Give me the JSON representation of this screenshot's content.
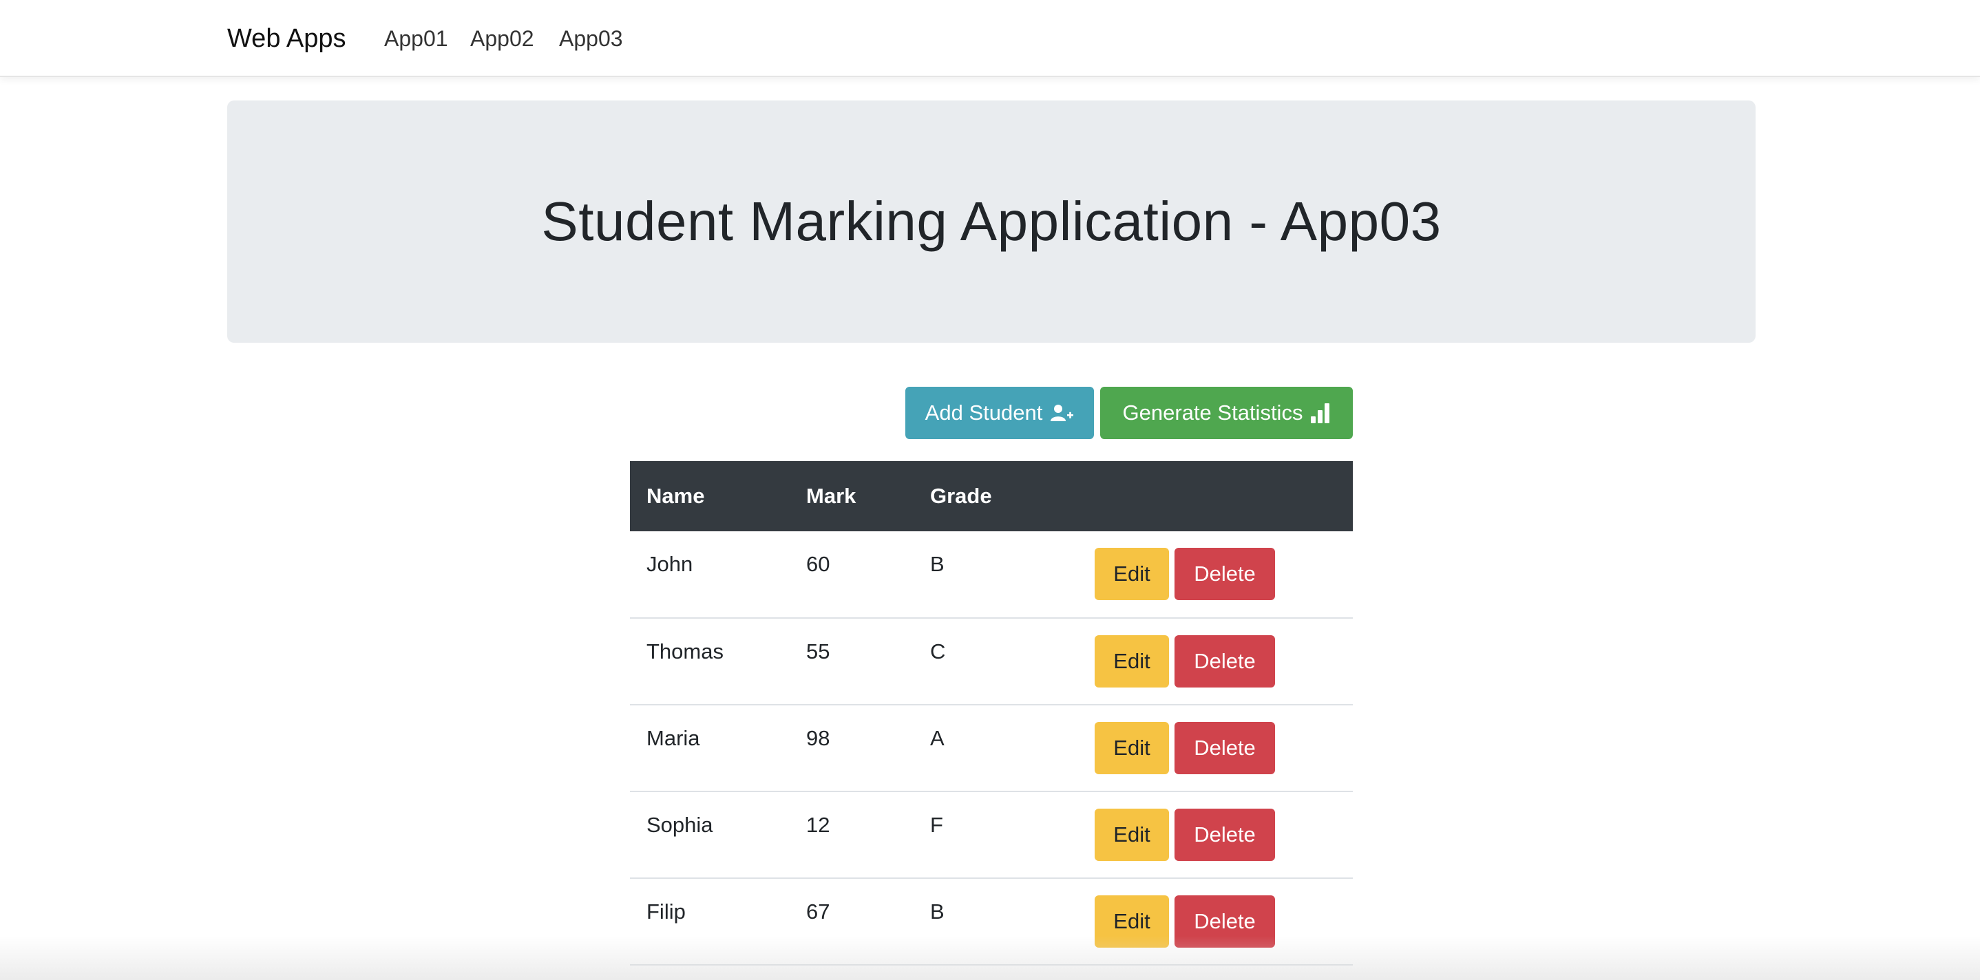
{
  "navbar": {
    "brand": "Web Apps",
    "links": [
      "App01",
      "App02",
      "App03"
    ]
  },
  "jumbotron": {
    "title": "Student Marking Application - App03"
  },
  "toolbar": {
    "add_label": "Add Student",
    "add_icon": "user-plus-icon",
    "stats_label": "Generate Statistics",
    "stats_icon": "bar-chart-icon"
  },
  "table": {
    "headers": [
      "Name",
      "Mark",
      "Grade",
      ""
    ],
    "rows": [
      {
        "name": "John",
        "mark": "60",
        "grade": "B"
      },
      {
        "name": "Thomas",
        "mark": "55",
        "grade": "C"
      },
      {
        "name": "Maria",
        "mark": "98",
        "grade": "A"
      },
      {
        "name": "Sophia",
        "mark": "12",
        "grade": "F"
      },
      {
        "name": "Filip",
        "mark": "67",
        "grade": "B"
      }
    ],
    "edit_label": "Edit",
    "delete_label": "Delete"
  },
  "colors": {
    "info": "#45a3b7",
    "success": "#4fa74f",
    "warning": "#f6c343",
    "danger": "#d0434c",
    "table_header": "#343a40",
    "jumbotron": "#e9ecef"
  }
}
